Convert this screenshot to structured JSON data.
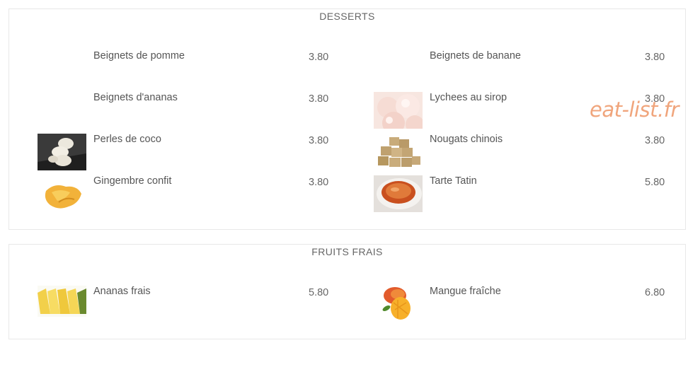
{
  "watermark": "eat-list.fr",
  "desserts": {
    "title": "DESSERTS",
    "items": [
      {
        "name": "Beignets de pomme",
        "price": "3.80"
      },
      {
        "name": "Beignets de banane",
        "price": "3.80"
      },
      {
        "name": "Beignets d'ananas",
        "price": "3.80"
      },
      {
        "name": "Lychees au sirop",
        "price": "3.80"
      },
      {
        "name": "Perles de coco",
        "price": "3.80"
      },
      {
        "name": "Nougats chinois",
        "price": "3.80"
      },
      {
        "name": "Gingembre confit",
        "price": "3.80"
      },
      {
        "name": "Tarte Tatin",
        "price": "5.80"
      }
    ]
  },
  "fruits": {
    "title": "FRUITS FRAIS",
    "items": [
      {
        "name": "Ananas frais",
        "price": "5.80"
      },
      {
        "name": "Mangue fraîche",
        "price": "6.80"
      }
    ]
  }
}
